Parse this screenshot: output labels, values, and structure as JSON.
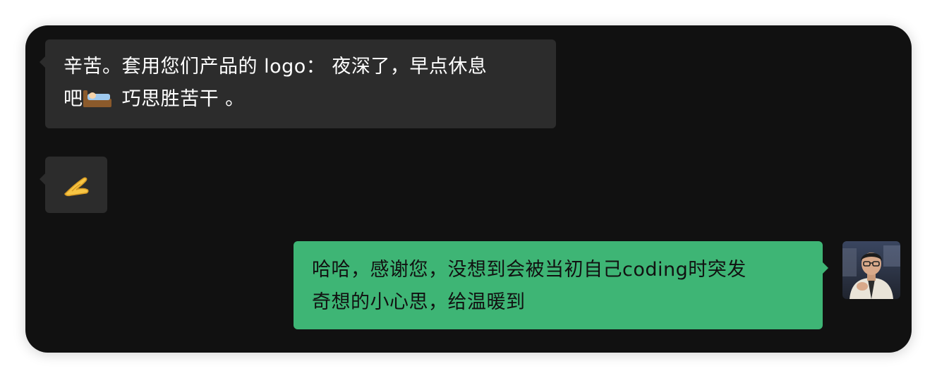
{
  "messages": [
    {
      "id": "msg1",
      "direction": "incoming",
      "line1": "辛苦。套用您们产品的 logo： 夜深了，早点休息",
      "line2_prefix": "吧",
      "line2_emoji": "bed-icon",
      "line2_suffix": " 巧思胜苦干 。"
    },
    {
      "id": "msg2",
      "direction": "incoming",
      "emoji": "pinching-hand-icon"
    },
    {
      "id": "msg3",
      "direction": "outgoing",
      "line1": "哈哈，感谢您，没想到会被当初自己coding时突发",
      "line2": "奇想的小心思，给温暖到"
    }
  ],
  "colors": {
    "window_bg": "#111111",
    "incoming_bubble": "#2c2c2c",
    "outgoing_bubble": "#3eb575",
    "incoming_text": "#ffffff",
    "outgoing_text": "#111111"
  }
}
